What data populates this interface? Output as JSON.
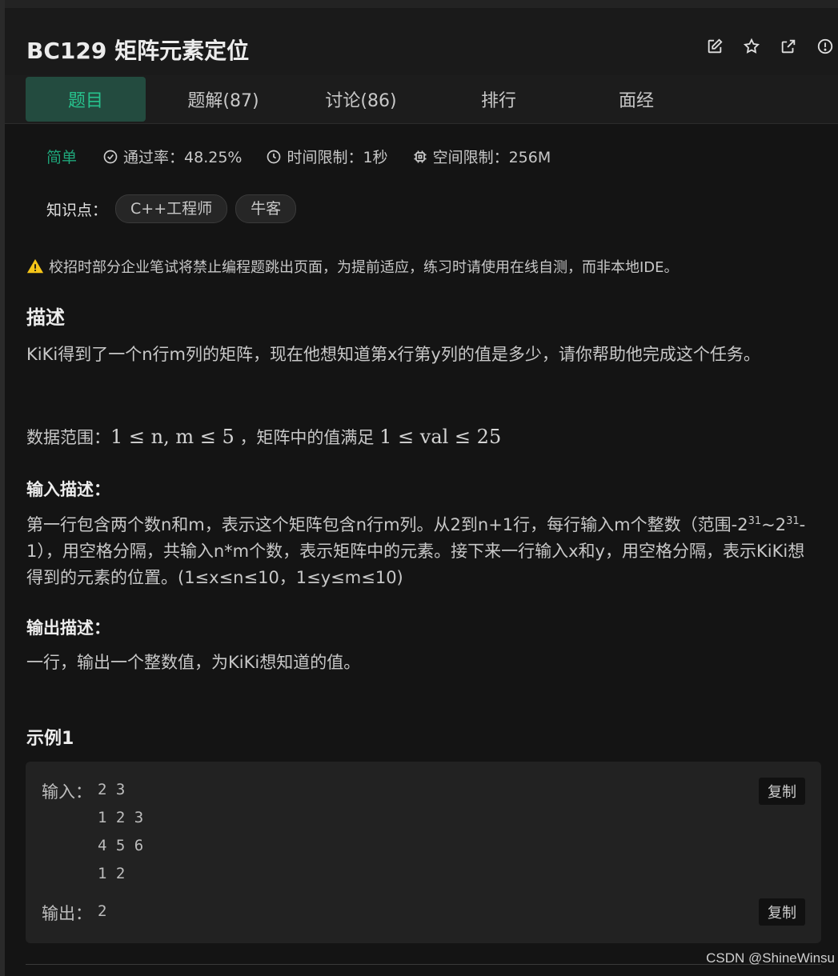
{
  "problem": {
    "title": "BC129  矩阵元素定位"
  },
  "tabs": [
    {
      "label": "题目"
    },
    {
      "label": "题解(87)"
    },
    {
      "label": "讨论(86)"
    },
    {
      "label": "排行"
    },
    {
      "label": "面经"
    }
  ],
  "meta": {
    "difficulty": "简单",
    "pass_rate": "通过率：48.25%",
    "time_limit": "时间限制：1秒",
    "space_limit": "空间限制：256M"
  },
  "knowledge": {
    "label": "知识点：",
    "tags": [
      "C++工程师",
      "牛客"
    ]
  },
  "notice": "校招时部分企业笔试将禁止编程题跳出页面，为提前适应，练习时请使用在线自测，而非本地IDE。",
  "description": {
    "title": "描述",
    "text": "KiKi得到了一个n行m列的矩阵，现在他想知道第x行第y列的值是多少，请你帮助他完成这个任务。",
    "range_prefix": "数据范围：",
    "range_formula1": "1 ≤ n, m ≤ 5",
    "range_middle": "，矩阵中的值满足",
    "range_formula2": "1 ≤ val ≤ 25"
  },
  "input_desc": {
    "title": "输入描述：",
    "text_part1": "第一行包含两个数n和m，表示这个矩阵包含n行m列。从2到n+1行，每行输入m个整数（范围-2",
    "sup1": "31",
    "text_part2": "~2",
    "sup2": "31",
    "text_part3": "-1），用空格分隔，共输入n*m个数，表示矩阵中的元素。接下来一行输入x和y，用空格分隔，表示KiKi想得到的元素的位置。(1≤x≤n≤10，1≤y≤m≤10)"
  },
  "output_desc": {
    "title": "输出描述：",
    "text": "一行，输出一个整数值，为KiKi想知道的值。"
  },
  "example": {
    "title": "示例1",
    "input_label": "输入：",
    "input_lines": "2 3\n1 2 3\n4 5 6\n1 2",
    "output_label": "输出：",
    "output_lines": "2",
    "copy_label": "复制"
  },
  "watermark": "CSDN @ShineWinsu",
  "colors": {
    "accent_green": "#27c28d",
    "active_tab_bg": "#234b3f",
    "warning_yellow": "#f5c518"
  }
}
